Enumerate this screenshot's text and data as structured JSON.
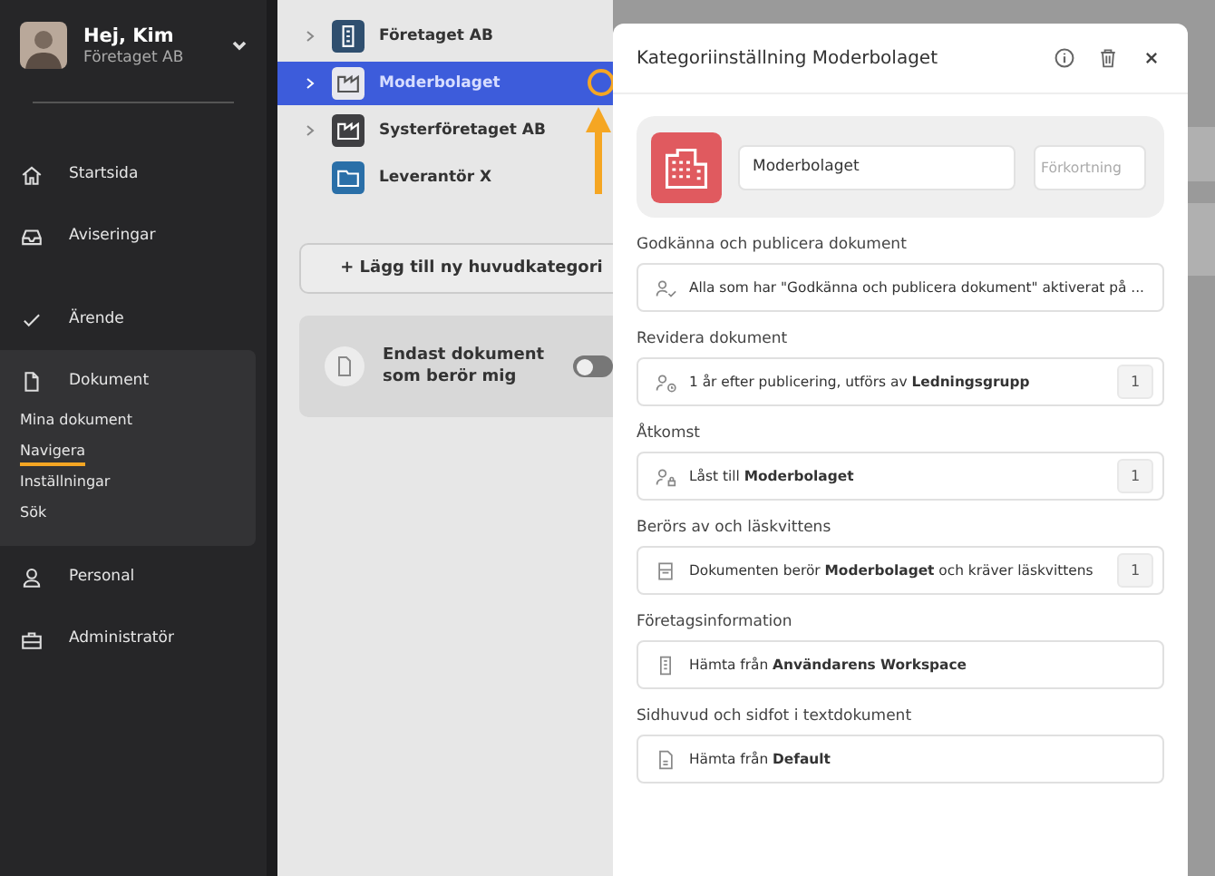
{
  "sidebar": {
    "user": {
      "greeting": "Hej, Kim",
      "company": "Företaget AB"
    },
    "items": [
      {
        "label": "Startsida"
      },
      {
        "label": "Aviseringar"
      },
      {
        "label": "Ärende"
      },
      {
        "label": "Dokument",
        "children": [
          {
            "label": "Mina dokument",
            "selected": false
          },
          {
            "label": "Navigera",
            "selected": true
          },
          {
            "label": "Inställningar",
            "selected": false
          },
          {
            "label": "Sök",
            "selected": false
          }
        ]
      },
      {
        "label": "Personal"
      },
      {
        "label": "Administratör"
      }
    ]
  },
  "tree": {
    "items": [
      {
        "label": "Företaget AB",
        "expandable": true,
        "color": "#2f4f6f",
        "selected": false
      },
      {
        "label": "Moderbolaget",
        "expandable": true,
        "color": "#e8e8ee",
        "selected": true
      },
      {
        "label": "Systerföretaget AB",
        "expandable": true,
        "color": "#3f3f42",
        "selected": false
      },
      {
        "label": "Leverantör X",
        "expandable": false,
        "color": "#2a6fa8",
        "selected": false
      }
    ],
    "add_button": "+ Lägg till ny huvudkategori",
    "filter": {
      "label": "Endast dokument som berör mig",
      "on": false
    }
  },
  "dialog": {
    "title": "Kategoriinställning Moderbolaget",
    "name_value": "Moderbolaget",
    "abbreviation_placeholder": "Förkortning",
    "sections": [
      {
        "label": "Godkänna och publicera dokument",
        "text": "Alla som har \"Godkänna och publicera dokument\" aktiverat på ..."
      },
      {
        "label": "Revidera dokument",
        "text": "1 år efter publicering, utförs av **Ledningsgrupp**",
        "count": "1"
      },
      {
        "label": "Åtkomst",
        "text": "Låst till **Moderbolaget**",
        "count": "1"
      },
      {
        "label": "Berörs av och läskvittens",
        "text": "Dokumenten berör **Moderbolaget** och kräver läskvittens",
        "count": "1"
      },
      {
        "label": "Företagsinformation",
        "text": "Hämta från **Användarens Workspace**"
      },
      {
        "label": "Sidhuvud och sidfot i textdokument",
        "text": "Hämta från **Default**"
      }
    ]
  }
}
